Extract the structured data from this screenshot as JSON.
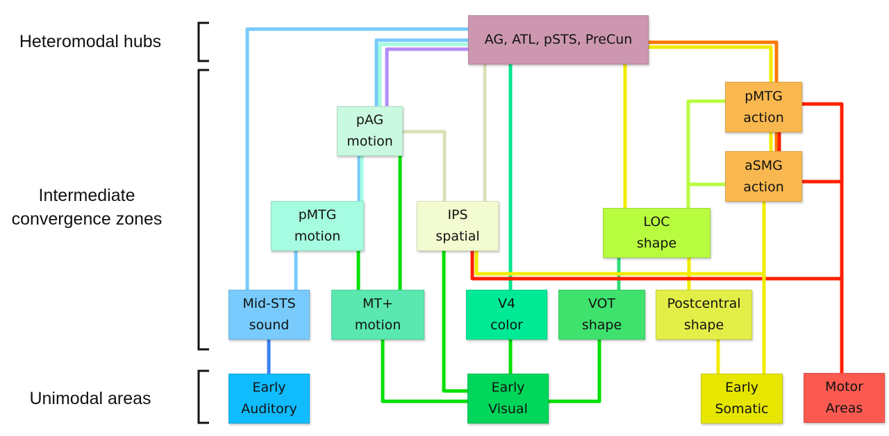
{
  "levels": [
    {
      "id": "hub",
      "label": "Heteromodal hubs"
    },
    {
      "id": "conv",
      "label": "Intermediate convergence zones"
    },
    {
      "id": "uni",
      "label": "Unimodal areas"
    }
  ],
  "nodes": {
    "hub": {
      "lines": [
        "AG, ATL, pSTS, PreCun"
      ],
      "color": "#cc97af"
    },
    "pag": {
      "lines": [
        "pAG",
        "motion"
      ],
      "color": "#c9f9e0"
    },
    "pmtg_m": {
      "lines": [
        "pMTG",
        "motion"
      ],
      "color": "#a6fce0"
    },
    "ips": {
      "lines": [
        "IPS",
        "spatial"
      ],
      "color": "#f2fcd0"
    },
    "loc": {
      "lines": [
        "LOC",
        "shape"
      ],
      "color": "#b8fc40"
    },
    "pmtg_a": {
      "lines": [
        "pMTG",
        "action"
      ],
      "color": "#f9b84f"
    },
    "asmg": {
      "lines": [
        "aSMG",
        "action"
      ],
      "color": "#f9b84f"
    },
    "midsts": {
      "lines": [
        "Mid-STS",
        "sound"
      ],
      "color": "#78cbfc"
    },
    "mt": {
      "lines": [
        "MT+",
        "motion"
      ],
      "color": "#5ae8b0"
    },
    "v4": {
      "lines": [
        "V4",
        "color"
      ],
      "color": "#00ea96"
    },
    "vot": {
      "lines": [
        "VOT",
        "shape"
      ],
      "color": "#40e26e"
    },
    "postc": {
      "lines": [
        "Postcentral",
        "shape"
      ],
      "color": "#e4ee48"
    },
    "e_aud": {
      "lines": [
        "Early",
        "Auditory"
      ],
      "color": "#10bcfc"
    },
    "e_vis": {
      "lines": [
        "Early",
        "Visual"
      ],
      "color": "#00d65a"
    },
    "e_som": {
      "lines": [
        "Early",
        "Somatic"
      ],
      "color": "#e6e600"
    },
    "motor": {
      "lines": [
        "Motor",
        "Areas"
      ],
      "color": "#fc5a50"
    }
  },
  "connections": [
    {
      "name": "hub-midsts",
      "color": "#78cbfc"
    },
    {
      "name": "hub-pmtg-motion",
      "color": "#78cbfc"
    },
    {
      "name": "hub-pag-aqua",
      "color": "#a6fce0"
    },
    {
      "name": "hub-pag-purple",
      "color": "#b48cf8"
    },
    {
      "name": "hub-ips",
      "color": "#dce0b8"
    },
    {
      "name": "hub-v4",
      "color": "#00e68c"
    },
    {
      "name": "hub-loc",
      "color": "#f2ec00"
    },
    {
      "name": "hub-pmtg-action-orange",
      "color": "#ff7a00"
    },
    {
      "name": "hub-asmg-yellow",
      "color": "#f2ec00"
    },
    {
      "name": "pag-ips",
      "color": "#dce0b8"
    },
    {
      "name": "pag-mt",
      "color": "#00e000"
    },
    {
      "name": "pmtg-motion-midsts",
      "color": "#78cbfc"
    },
    {
      "name": "pmtg-motion-mt",
      "color": "#00e000"
    },
    {
      "name": "midsts-early-auditory",
      "color": "#3c82f0"
    },
    {
      "name": "mt-early-visual",
      "color": "#00e000"
    },
    {
      "name": "ips-early-visual",
      "color": "#00e000"
    },
    {
      "name": "v4-early-visual",
      "color": "#00e000"
    },
    {
      "name": "vot-early-visual",
      "color": "#00e000"
    },
    {
      "name": "loc-vot",
      "color": "#30dc78"
    },
    {
      "name": "loc-postcentral",
      "color": "#f2ec00"
    },
    {
      "name": "loc-pmtg-action",
      "color": "#b8fc40"
    },
    {
      "name": "loc-asmg",
      "color": "#b8fc40"
    },
    {
      "name": "pmtg-action-asmg-red",
      "color": "#ff2000"
    },
    {
      "name": "pmtg-action-motor",
      "color": "#ff2000"
    },
    {
      "name": "asmg-motor",
      "color": "#ff2000"
    },
    {
      "name": "ips-motor-red",
      "color": "#ff2000"
    },
    {
      "name": "ips-somatic-yellow",
      "color": "#f2ec00"
    },
    {
      "name": "asmg-early-somatic",
      "color": "#f2ec00"
    },
    {
      "name": "postcentral-early-somatic",
      "color": "#f2ec00"
    }
  ]
}
